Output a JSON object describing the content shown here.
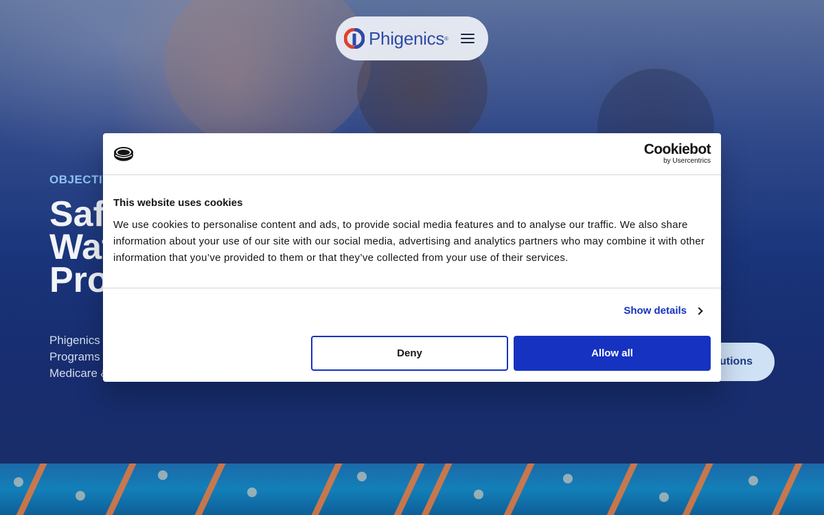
{
  "nav": {
    "brand": "Phigenics",
    "brand_mark": "®",
    "menu_icon": "hamburger-menu-icon"
  },
  "hero": {
    "eyebrow": "OBJECTIVI",
    "title_lines": [
      "Safe",
      "Wat",
      "Pro"
    ],
    "description_lines": [
      "Phigenics i",
      "Programs",
      "Medicare &"
    ],
    "cta_label": "utions"
  },
  "cookie_dialog": {
    "brand_icon": "cookie-logo-icon",
    "vendor_name": "Cookiebot",
    "vendor_sub": "by Usercentrics",
    "title": "This website uses cookies",
    "body": "We use cookies to personalise content and ads, to provide social media features and to analyse our traffic. We also share information about your use of our site with our social media, advertising and analytics partners who may combine it with other information that you’ve provided to them or that they’ve collected from your use of their services.",
    "show_details_label": "Show details",
    "deny_label": "Deny",
    "allow_label": "Allow all"
  },
  "colors": {
    "accent": "#1532c1",
    "brand_blue": "#2d4aa8",
    "brand_red": "#e0412b",
    "eyebrow": "#8fc1f5"
  }
}
